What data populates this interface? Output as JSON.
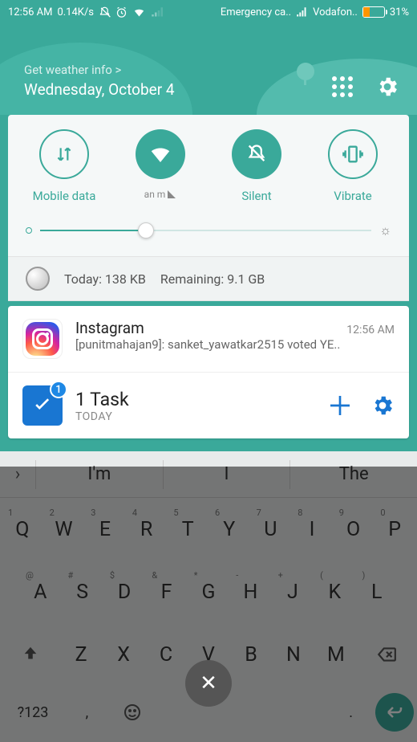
{
  "status": {
    "time": "12:56 AM",
    "net_speed": "0.14K/s",
    "emergency": "Emergency ca..",
    "carrier": "Vodafon..",
    "battery_pct": "31%"
  },
  "header": {
    "weather_link": "Get weather info >",
    "date": "Wednesday, October 4"
  },
  "qs": {
    "mobile_data": "Mobile data",
    "wifi": "an    m",
    "silent": "Silent",
    "vibrate": "Vibrate"
  },
  "data_usage": {
    "today_label": "Today: 138 KB",
    "remaining_label": "Remaining: 9.1 GB"
  },
  "notifications": [
    {
      "app": "Instagram",
      "time": "12:56 AM",
      "text": "[punitmahajan9]: sanket_yawatkar2515 voted YE.."
    }
  ],
  "task": {
    "title": "1 Task",
    "subtitle": "TODAY",
    "badge": "1"
  },
  "keyboard": {
    "suggestions": [
      "I'm",
      "I",
      "The"
    ],
    "row1": [
      "Q",
      "W",
      "E",
      "R",
      "T",
      "Y",
      "U",
      "I",
      "O",
      "P"
    ],
    "row1_alt": [
      "1",
      "2",
      "3",
      "4",
      "5",
      "6",
      "7",
      "8",
      "9",
      "0"
    ],
    "row2": [
      "A",
      "S",
      "D",
      "F",
      "G",
      "H",
      "J",
      "K",
      "L"
    ],
    "row2_alt": [
      "@",
      "#",
      "$",
      "&",
      "*",
      "-",
      "+",
      "(",
      ")"
    ],
    "row3": [
      "Z",
      "X",
      "C",
      "V",
      "B",
      "N",
      "M"
    ],
    "bottom": {
      "symbols": "?123",
      "comma": ",",
      "period": "."
    }
  }
}
